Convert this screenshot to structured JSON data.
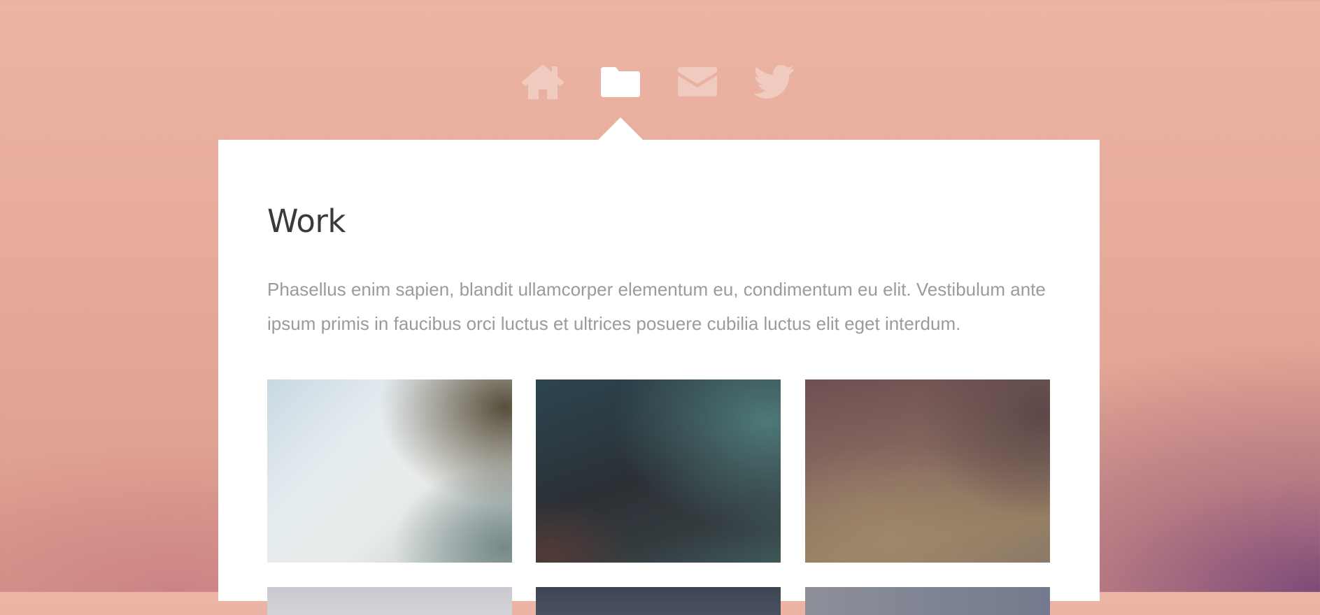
{
  "nav": {
    "items": [
      {
        "id": "home",
        "icon": "home-icon",
        "active": false
      },
      {
        "id": "work",
        "icon": "folder-icon",
        "active": true
      },
      {
        "id": "contact",
        "icon": "envelope-icon",
        "active": false
      },
      {
        "id": "twitter",
        "icon": "twitter-bird-icon",
        "active": false
      }
    ]
  },
  "panel": {
    "title": "Work",
    "text": "Phasellus enim sapien, blandit ullamcorper elementum eu, condimentum eu elit. Vestibulum ante ipsum primis in faucibus orci luctus et ultrices posuere cubilia luctus elit eget interdum."
  },
  "gallery": {
    "items": [
      {
        "id": "work-item-1"
      },
      {
        "id": "work-item-2"
      },
      {
        "id": "work-item-3"
      },
      {
        "id": "work-item-4"
      },
      {
        "id": "work-item-5"
      },
      {
        "id": "work-item-6"
      }
    ]
  },
  "colors": {
    "background_top": "#ecb4a5",
    "background_corner": "#784678",
    "panel": "#ffffff",
    "title": "#3a3a3a",
    "body_text": "#9b9b9b",
    "nav_inactive": "rgba(255,255,255,0.32)",
    "nav_active": "#ffffff"
  }
}
